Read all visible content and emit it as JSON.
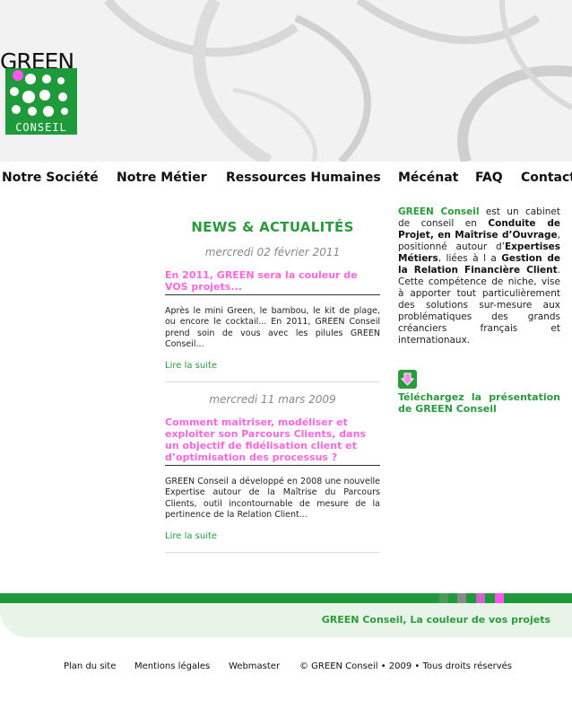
{
  "logo": {
    "word": "GREEN",
    "sub": "CONSEIL"
  },
  "nav": [
    "Notre Société",
    "Notre Métier",
    "Ressources Humaines",
    "Mécénat",
    "FAQ",
    "Contact"
  ],
  "news": {
    "heading": "NEWS & ACTUALITÉS",
    "articles": [
      {
        "date": "mercredi 02 février 2011",
        "title": "En 2011, GREEN sera la couleur de VOS projets...",
        "body": "Après le mini Green, le bambou, le kit de plage, ou encore le cocktail... En 2011, GREEN Conseil prend soin de vous avec les pilules GREEN Conseil...",
        "more": "Lire la suite"
      },
      {
        "date": "mercredi 11 mars 2009",
        "title": "Comment maîtriser, modéliser et exploiter son Parcours Clients, dans un objectif de fidélisation client et d’optimisation des processus ?",
        "body": "GREEN Conseil a développé en 2008 une nouvelle Expertise autour de la Maîtrise du Parcours Clients, outil incontournable de mesure de la pertinence de la Relation Client...",
        "more": "Lire la suite"
      }
    ]
  },
  "side": {
    "brand": "GREEN Conseil",
    "t1": " est un cabinet de conseil en ",
    "b1": "Conduite de Projet, en Maîtrise d’Ouvrage",
    "t2": ", positionné autour d’",
    "b2": "Expertises Métiers",
    "t3": ", liées à l a ",
    "b3": "Gestion de la Relation Financière Client",
    "t4": ". Cette compétence de niche, vise à apporter tout particulièrement des solutions sur-mesure aux problématiques des grands créanciers français et internationaux.",
    "download": "Téléchargez la présentation de GREEN Conseil"
  },
  "tagline": "GREEN Conseil, La couleur de vos projets",
  "colors": {
    "green": "#2a9a3c",
    "pink": "#ff66dd"
  },
  "footer": [
    "Plan du site",
    "Mentions légales",
    "Webmaster",
    "© GREEN Conseil • 2009 • Tous droits réservés"
  ]
}
